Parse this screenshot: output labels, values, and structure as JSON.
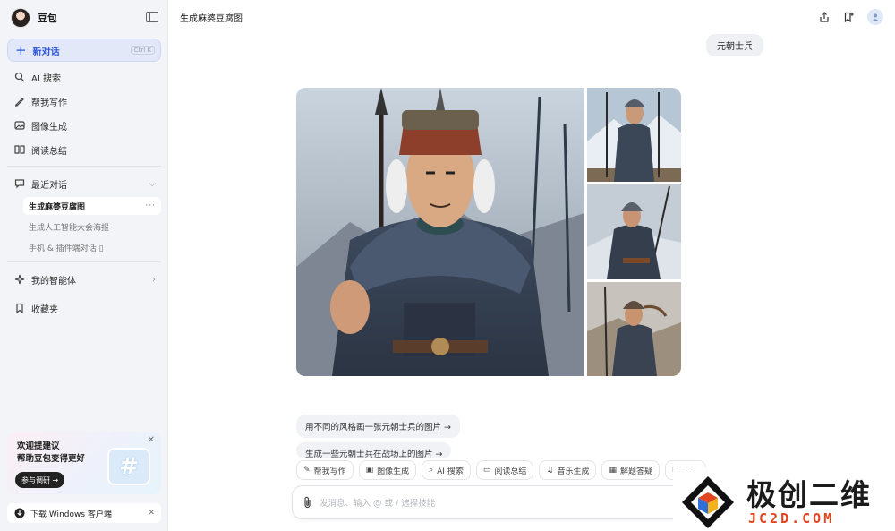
{
  "sidebar": {
    "brand": "豆包",
    "new_chat": {
      "label": "新对话",
      "shortcut": "Ctrl K"
    },
    "nav": [
      {
        "label": "AI 搜索",
        "icon": "ai-search-icon"
      },
      {
        "label": "帮我写作",
        "icon": "pen-icon"
      },
      {
        "label": "图像生成",
        "icon": "image-icon"
      },
      {
        "label": "阅读总结",
        "icon": "book-icon"
      }
    ],
    "recent": {
      "label": "最近对话",
      "items": [
        "生成麻婆豆腐图",
        "生成人工智能大会海报",
        "手机 & 插件端对话 ▯"
      ]
    },
    "agents": "我的智能体",
    "favorites": "收藏夹",
    "promo": {
      "line1": "欢迎提建议",
      "line2": "帮助豆包变得更好",
      "button": "参与调研 →"
    },
    "download": "下载 Windows 客户端"
  },
  "header": {
    "title": "生成麻婆豆腐图"
  },
  "conversation": {
    "user_message": "元朝士兵",
    "suggestions": [
      "用不同的风格画一张元朝士兵的图片 →",
      "生成一些元朝士兵在战场上的图片 →"
    ]
  },
  "tools": [
    "帮我写作",
    "图像生成",
    "AI 搜索",
    "阅读总结",
    "音乐生成",
    "解题答疑",
    "更多"
  ],
  "input": {
    "placeholder": "发消息、输入 @ 或 / 选择技能"
  },
  "watermark": {
    "title": "极创二维",
    "sub": "JC2D.COM"
  },
  "colors": {
    "accent": "#2b54d6",
    "sidebar_bg": "#f3f4f7",
    "watermark_red": "#e24620"
  }
}
